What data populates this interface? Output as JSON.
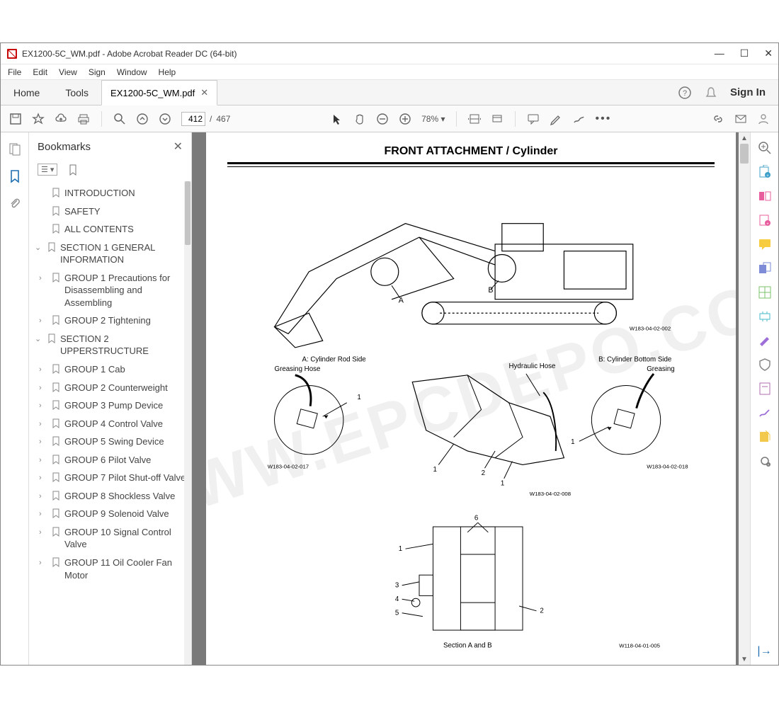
{
  "window": {
    "title": "EX1200-5C_WM.pdf - Adobe Acrobat Reader DC (64-bit)"
  },
  "menu": {
    "file": "File",
    "edit": "Edit",
    "view": "View",
    "sign": "Sign",
    "window": "Window",
    "help": "Help"
  },
  "tabs": {
    "home": "Home",
    "tools": "Tools",
    "doc": "EX1200-5C_WM.pdf",
    "signin": "Sign In"
  },
  "toolbar": {
    "page_current": "412",
    "page_sep": "/",
    "page_total": "467",
    "zoom": "78%"
  },
  "bookmarks": {
    "title": "Bookmarks",
    "items": {
      "intro": "INTRODUCTION",
      "safety": "SAFETY",
      "allcontents": "ALL CONTENTS",
      "sec1": "SECTION 1 GENERAL INFORMATION",
      "sec1_g1": "GROUP 1 Precautions for Disassembling and Assembling",
      "sec1_g2": "GROUP 2 Tightening",
      "sec2": "SECTION 2 UPPERSTRUCTURE",
      "sec2_g1": "GROUP 1 Cab",
      "sec2_g2": "GROUP 2 Counterweight",
      "sec2_g3": "GROUP 3 Pump Device",
      "sec2_g4": "GROUP 4 Control Valve",
      "sec2_g5": "GROUP 5 Swing Device",
      "sec2_g6": "GROUP 6 Pilot Valve",
      "sec2_g7": "GROUP 7 Pilot Shut-off Valve",
      "sec2_g8": "GROUP 8 Shockless Valve",
      "sec2_g9": "GROUP 9 Solenoid Valve",
      "sec2_g10": "GROUP 10 Signal Control Valve",
      "sec2_g11": "GROUP 11 Oil Cooler Fan Motor"
    }
  },
  "page": {
    "heading": "FRONT ATTACHMENT / Cylinder",
    "label_a": "A: Cylinder Rod Side",
    "label_greasing_hose": "Greasing Hose",
    "label_hydraulic_hose": "Hydraulic Hose",
    "label_b": "B: Cylinder Bottom Side",
    "label_greasing": "Greasing",
    "section_ab": "Section   A and B",
    "ref1": "W183-04-02-002",
    "ref2": "W183-04-02-017",
    "ref3": "W183-04-02-008",
    "ref4": "W183-04-02-018",
    "ref5": "W118-04-01-005",
    "num1": "1",
    "num2": "2",
    "num3": "3",
    "num4": "4",
    "num5": "5",
    "num6": "6",
    "markA": "A",
    "markB": "B",
    "watermark": "WWW.EPCDEPO.COM"
  }
}
